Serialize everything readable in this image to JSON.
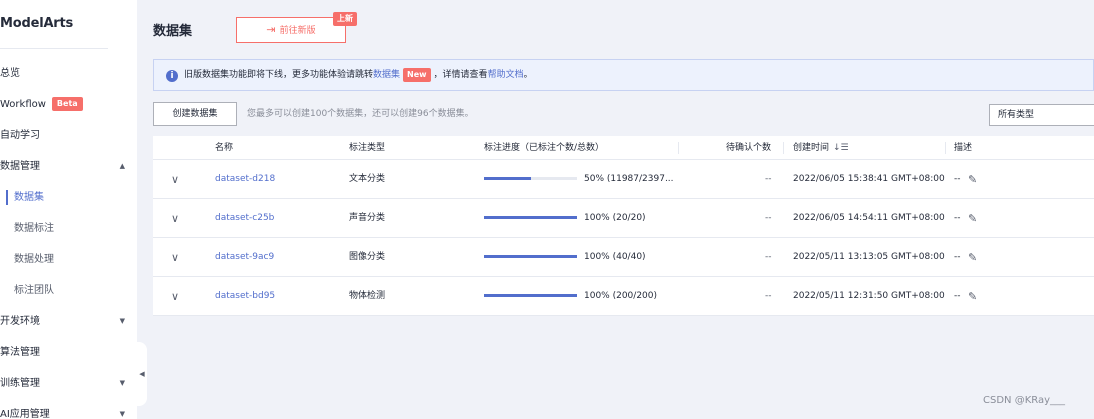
{
  "sidebar": {
    "brand": "ModelArts",
    "items": [
      {
        "label": "总览"
      },
      {
        "label": "Workflow",
        "badge": "Beta"
      },
      {
        "label": "自动学习"
      },
      {
        "label": "数据管理",
        "arrow": "▲"
      },
      {
        "label": "数据集"
      },
      {
        "label": "数据标注"
      },
      {
        "label": "数据处理"
      },
      {
        "label": "标注团队"
      },
      {
        "label": "开发环境",
        "arrow": "▼"
      },
      {
        "label": "算法管理"
      },
      {
        "label": "训练管理",
        "arrow": "▼"
      },
      {
        "label": "AI应用管理",
        "arrow": "▼"
      }
    ],
    "collapse_icon": "◀"
  },
  "header": {
    "title": "数据集",
    "switch_label": "前往新版",
    "switch_icon": "⇥",
    "new_tag": "上新"
  },
  "notice": {
    "icon": "i",
    "text_before": "旧版数据集功能即将下线，更多功能体验请跳转",
    "link1": "数据集",
    "badge": "New",
    "text_middle": "，详情请查看",
    "link2": "帮助文档",
    "text_end": "。"
  },
  "toolbar": {
    "create_label": "创建数据集",
    "tip": "您最多可以创建100个数据集，还可以创建96个数据集。",
    "type_select": "所有类型"
  },
  "table": {
    "headers": {
      "name": "名称",
      "label_type": "标注类型",
      "progress": "标注进度（已标注个数/总数）",
      "pending": "待确认个数",
      "created": "创建时间",
      "desc": "描述"
    },
    "sort_icon": "↓☰",
    "rows": [
      {
        "chev": "∨",
        "name": "dataset-d218",
        "type": "文本分类",
        "progress": 0.5,
        "progress_text": "50% (11987/2397...",
        "pending": "--",
        "created": "2022/06/05 15:38:41 GMT+08:00",
        "desc": "--",
        "edit": "✎"
      },
      {
        "chev": "∨",
        "name": "dataset-c25b",
        "type": "声音分类",
        "progress": 1.0,
        "progress_text": "100% (20/20)",
        "pending": "--",
        "created": "2022/06/05 14:54:11 GMT+08:00",
        "desc": "--",
        "edit": "✎"
      },
      {
        "chev": "∨",
        "name": "dataset-9ac9",
        "type": "图像分类",
        "progress": 1.0,
        "progress_text": "100% (40/40)",
        "pending": "--",
        "created": "2022/05/11 13:13:05 GMT+08:00",
        "desc": "--",
        "edit": "✎"
      },
      {
        "chev": "∨",
        "name": "dataset-bd95",
        "type": "物体检测",
        "progress": 1.0,
        "progress_text": "100% (200/200)",
        "pending": "--",
        "created": "2022/05/11 12:31:50 GMT+08:00",
        "desc": "--",
        "edit": "✎"
      }
    ]
  },
  "watermark": "CSDN @KRay___",
  "colors": {
    "accent": "#526ecc",
    "danger": "#f66f6a",
    "bg": "#f0f2f8"
  }
}
